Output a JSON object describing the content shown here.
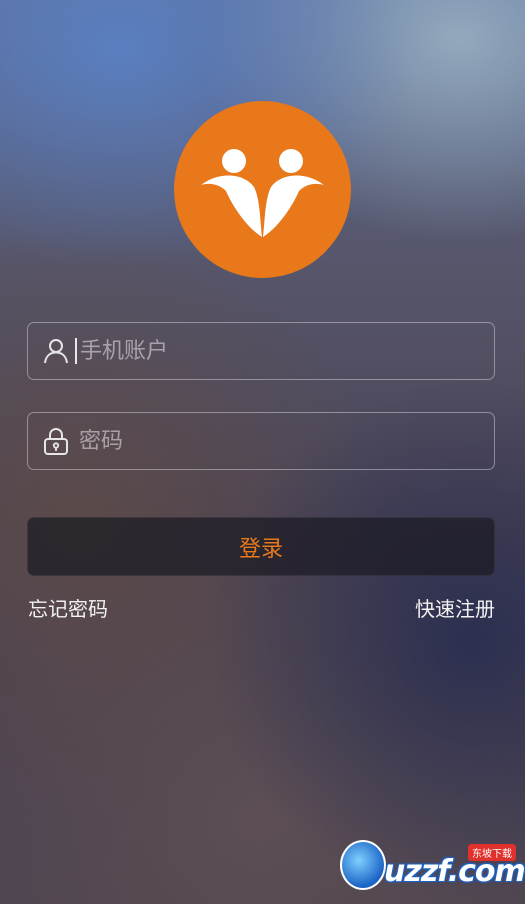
{
  "login": {
    "account_placeholder": "手机账户",
    "account_value": "",
    "password_placeholder": "密码",
    "password_value": "",
    "login_label": "登录",
    "forgot_label": "忘记密码",
    "register_label": "快速注册"
  },
  "icons": {
    "logo": "people-logo-icon",
    "account": "user-icon",
    "password": "lock-icon"
  },
  "colors": {
    "accent": "#e8781a",
    "button_bg": "#1c1a24"
  },
  "watermark": {
    "tag": "东坡下载",
    "brand": "uzzf.com"
  }
}
